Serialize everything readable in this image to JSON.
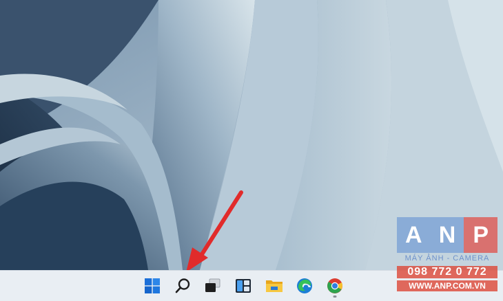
{
  "wallpaper": {
    "name": "Windows 11 Bloom wallpaper",
    "colors": {
      "dark": "#1c2e44",
      "mid": "#5d7a95",
      "light": "#b9cbd7",
      "lightest": "#d4e1e8"
    }
  },
  "annotation": {
    "color": "#e12b2b",
    "target": "search-button"
  },
  "taskbar": {
    "background": "#e9eef3",
    "items": [
      {
        "name": "start-button",
        "icon": "windows-logo-icon"
      },
      {
        "name": "search-button",
        "icon": "search-icon"
      },
      {
        "name": "task-view-button",
        "icon": "task-view-icon"
      },
      {
        "name": "widgets-button",
        "icon": "widgets-icon"
      },
      {
        "name": "file-explorer-button",
        "icon": "folder-icon"
      },
      {
        "name": "edge-button",
        "icon": "edge-icon"
      },
      {
        "name": "chrome-button",
        "icon": "chrome-icon",
        "running": true
      }
    ]
  },
  "watermark": {
    "letters": [
      "A",
      "N",
      "P"
    ],
    "letter_colors": [
      "#5b8ad1",
      "#5b8ad1",
      "#e0504a"
    ],
    "subtitle": "MÁY ẢNH - CAMERA",
    "phone": "098 772 0 772",
    "website": "WWW.ANP.COM.VN"
  }
}
